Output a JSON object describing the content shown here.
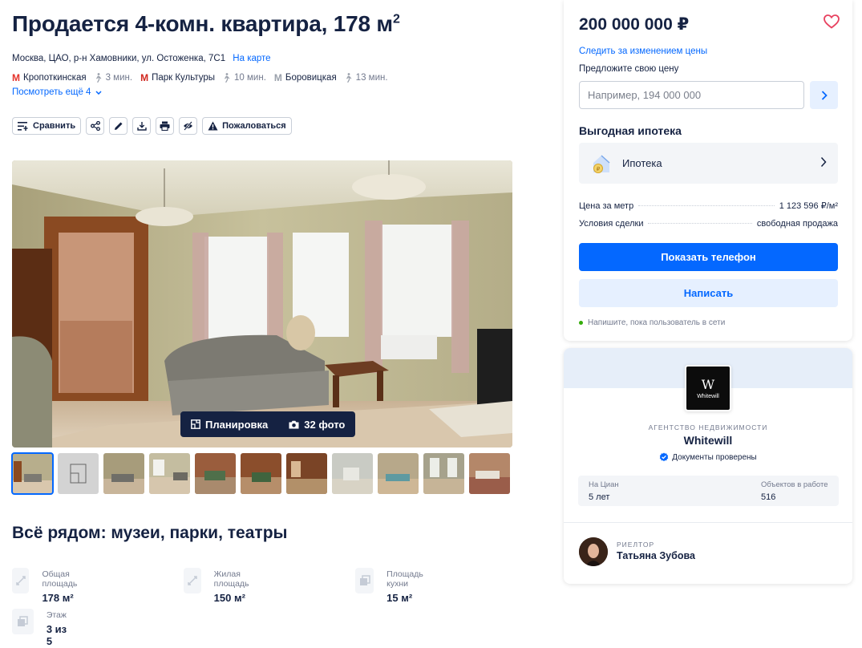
{
  "listing": {
    "title": "Продается 4-комн. квартира, 178 м",
    "title_sup": "2",
    "address": "Москва, ЦАО, р-н Хамовники, ул. Остоженка, 7С1",
    "map_link": "На карте",
    "metro": [
      {
        "name": "Кропоткинская",
        "walk": "3 мин.",
        "color": "#e4322a"
      },
      {
        "name": "Парк Культуры",
        "walk": "10 мин.",
        "color": "#d0271e"
      },
      {
        "name": "Боровицкая",
        "walk": "13 мин.",
        "color": "#9aa0ab"
      }
    ],
    "more_metro": "Посмотреть ещё 4"
  },
  "toolbar": {
    "compare": "Сравнить",
    "complain": "Пожаловаться",
    "icons": [
      "share-icon",
      "edit-icon",
      "download-icon",
      "print-icon",
      "hide-icon"
    ]
  },
  "gallery": {
    "plan_button": "Планировка",
    "photos_button": "32 фото",
    "thumbs_count": 11
  },
  "nearby": {
    "title": "Всё рядом: музеи, парки, театры"
  },
  "facts": [
    {
      "label": "Общая площадь",
      "value": "178 м²"
    },
    {
      "label": "Жилая площадь",
      "value": "150 м²"
    },
    {
      "label": "Площадь кухни",
      "value": "15 м²"
    },
    {
      "label": "Этаж",
      "value": "3 из 5"
    }
  ],
  "sidebar": {
    "price": "200 000 000 ₽",
    "follow_price": "Следить за изменением цены",
    "offer_label": "Предложите свою цену",
    "offer_placeholder": "Например, 194 000 000",
    "mortgage_title": "Выгодная ипотека",
    "mortgage_item": "Ипотека",
    "price_per_meter_label": "Цена за метр",
    "price_per_meter_value": "1 123 596 ₽/м²",
    "deal_label": "Условия сделки",
    "deal_value": "свободная продажа",
    "show_phone": "Показать телефон",
    "write": "Написать",
    "online_note": "Напишите, пока пользователь в сети"
  },
  "agency": {
    "logo_letter": "W",
    "logo_text": "Whitewill",
    "type": "АГЕНТСТВО НЕДВИЖИМОСТИ",
    "name": "Whitewill",
    "verified": "Документы проверены",
    "stat1_label": "На Циан",
    "stat1_value": "5 лет",
    "stat2_label": "Объектов в работе",
    "stat2_value": "516",
    "realtor_role": "РИЕЛТОР",
    "realtor_name": "Татьяна Зубова"
  },
  "colors": {
    "accent": "#0468ff",
    "accent_light": "#e6f0ff",
    "text": "#152242",
    "muted": "#737a8e",
    "online": "#34ac0a",
    "heart": "#e84260"
  }
}
